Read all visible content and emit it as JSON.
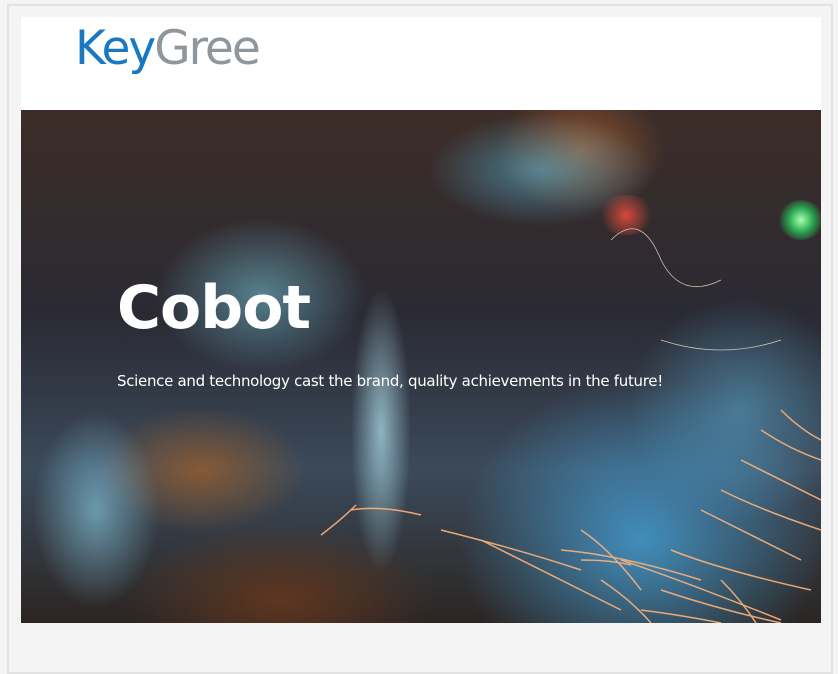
{
  "brand": {
    "logo_part1": "Key",
    "logo_part2": "Gree",
    "colors": {
      "key": "#1a78c2",
      "gree": "#8f979c"
    }
  },
  "hero": {
    "title": "Cobot",
    "subtitle": "Science and technology cast the brand, quality achievements in the future!",
    "background": "blurred-welding-sparks-photo"
  }
}
